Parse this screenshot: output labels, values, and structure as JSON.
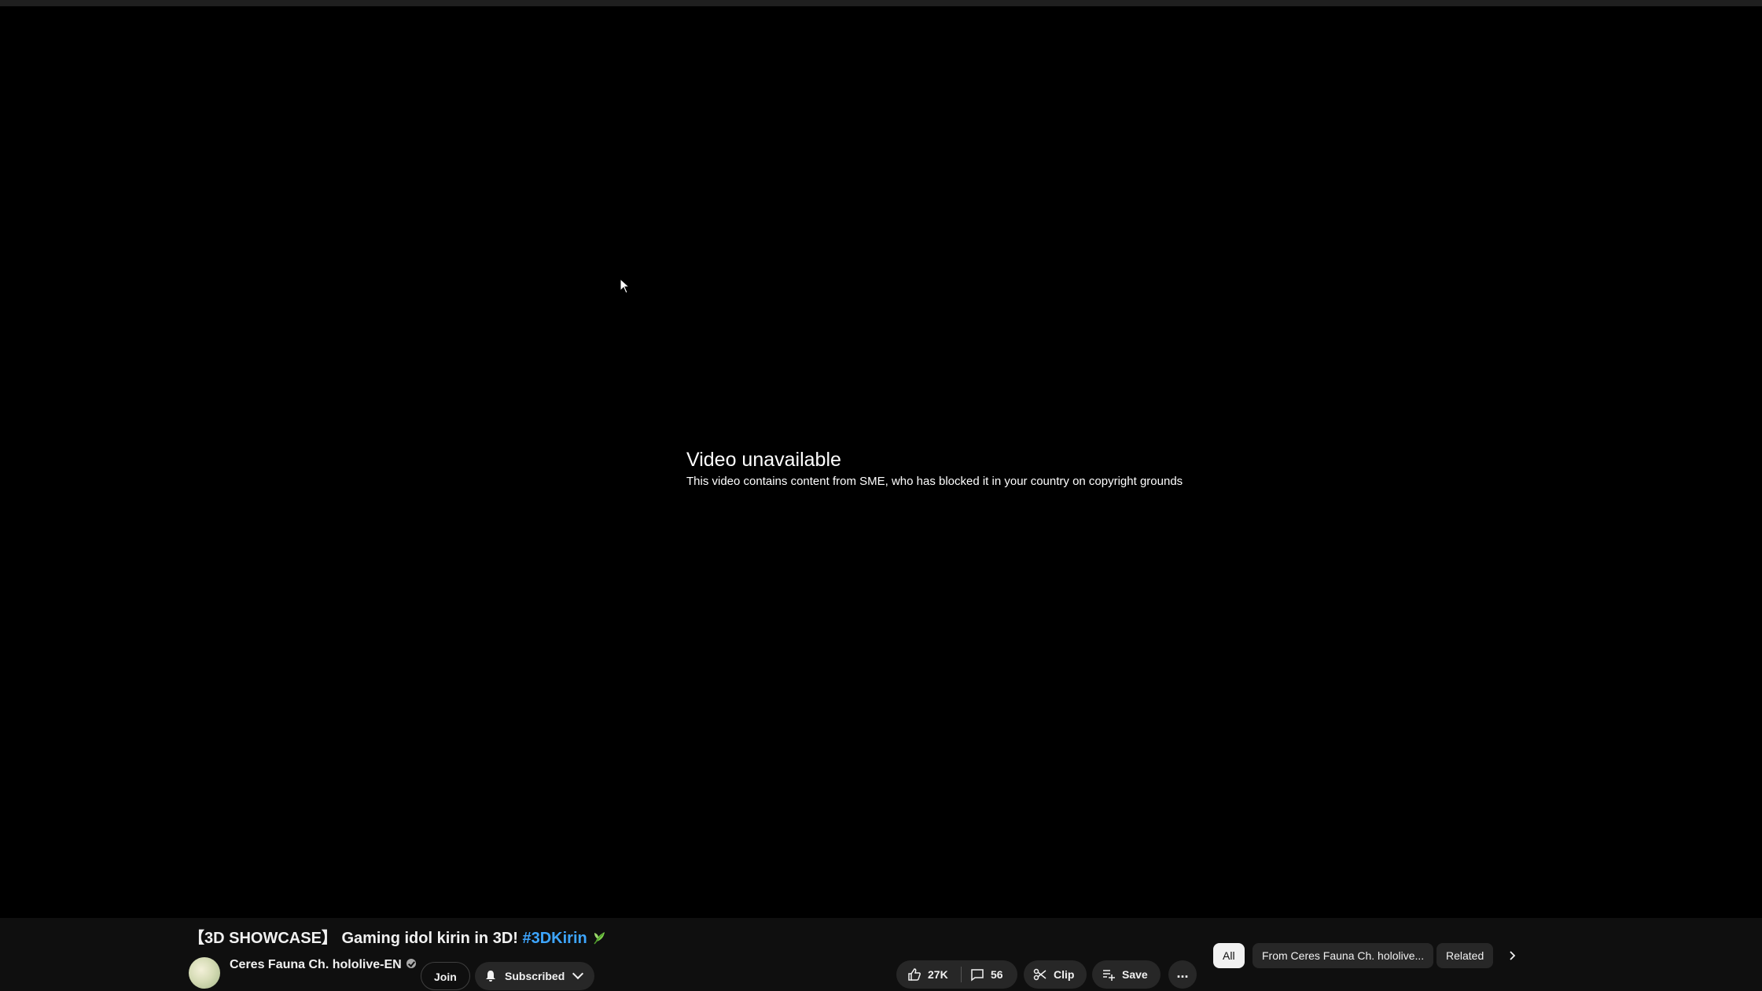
{
  "player": {
    "error_title": "Video unavailable",
    "error_message": "This video contains content from SME, who has blocked it in your country on copyright grounds"
  },
  "video": {
    "title_main": "【3D SHOWCASE】 Gaming idol kirin in 3D! ",
    "title_hashtag": "#3DKirin",
    "title_icon": "leaf-icon"
  },
  "channel": {
    "name": "Ceres Fauna Ch. hololive-EN",
    "verified": true,
    "join_label": "Join",
    "subscribed_label": "Subscribed"
  },
  "actions": {
    "like_count": "27K",
    "comment_count": "56",
    "clip_label": "Clip",
    "save_label": "Save",
    "more_label": "..."
  },
  "chips": {
    "all": "All",
    "channel": "From Ceres Fauna Ch. hololive...",
    "related": "Related"
  },
  "colors": {
    "background": "#0f0f0f",
    "player": "#000000",
    "hashtag": "#3ea6ff",
    "button": "#272727"
  }
}
